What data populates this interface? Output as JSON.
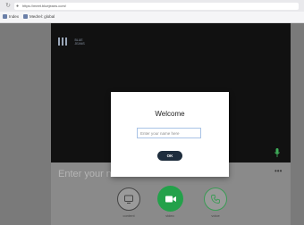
{
  "browser": {
    "url": "https://meet.bluejeans.com/",
    "bookmarks": [
      {
        "label": "Index"
      },
      {
        "label": "Medrel: global"
      }
    ]
  },
  "app": {
    "logo_line1": "BLUE",
    "logo_line2": "JEANS",
    "name_field_text": "Enter your na",
    "more_icon": "more-horizontal-icon",
    "controls": [
      {
        "label": "content",
        "icon": "screen-share-icon"
      },
      {
        "label": "video",
        "icon": "video-camera-icon",
        "color": "#23a14a"
      },
      {
        "label": "voice",
        "icon": "phone-icon",
        "color": "#3b9a55"
      }
    ]
  },
  "modal": {
    "title": "Welcome",
    "input_placeholder": "Enter your name here",
    "ok_label": "OK"
  },
  "colors": {
    "backdrop": "#6f6f6f",
    "video_bg": "#111111",
    "ok_button": "#1e2d3d",
    "accent_green": "#23a14a"
  }
}
